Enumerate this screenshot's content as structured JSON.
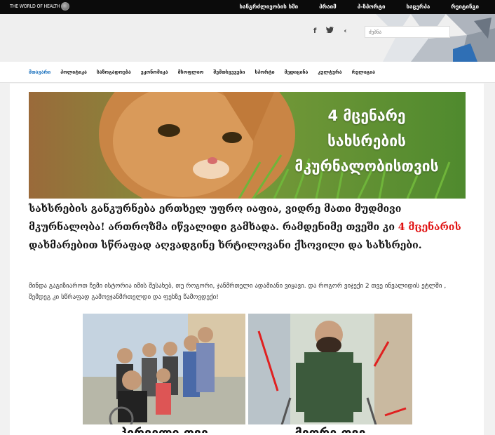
{
  "logo": {
    "text": "THE WORLD OF HEALTH"
  },
  "top_nav": [
    "ხანგრძლივობის ხმი",
    "პრაიმ",
    "პ-ზპორტი",
    "ხაცერპა",
    "რეიტინგი"
  ],
  "header": {
    "social_icons": [
      "facebook-icon",
      "twitter-icon",
      "share-icon"
    ],
    "search_placeholder": "ძებნა"
  },
  "categories": [
    {
      "label": "მთავარი",
      "active": true
    },
    {
      "label": "პოლიტიკა",
      "active": false
    },
    {
      "label": "საზოგადოება",
      "active": false
    },
    {
      "label": "ეკონომიკა",
      "active": false
    },
    {
      "label": "მსოფლიო",
      "active": false
    },
    {
      "label": "შემთხვევები",
      "active": false
    },
    {
      "label": "სპორტი",
      "active": false
    },
    {
      "label": "მედიცინა",
      "active": false
    },
    {
      "label": "კულტურა",
      "active": false
    },
    {
      "label": "რელიგია",
      "active": false
    }
  ],
  "hero": {
    "caption_line1": "4 მცენარე",
    "caption_line2": "სახსრების",
    "caption_line3": "მკურნალობისთვის"
  },
  "article": {
    "lead_part1": "სახსრების განკურნება ერთხელ უფრო იაფია, ვიდრე მათი მუდმივი მკურნალობა! ართროზმა იწვალიდი გამხადა. რამდენიმე თვეში კი ",
    "lead_highlight": "4 მცენარის",
    "lead_part2": " დახმარებით სწრაფად აღვადგინე ხრტილოვანი ქსოვილი და სახსრები.",
    "intro": "მინდა გაგიზიაროთ ჩემი ისტორია იმის შესახებ, თუ როგორი, ჯანმრთელი ადამიანი ვიყავი. და როგორ ვიჯექი 2 თვე ინვალიდის ეტლში , შემდეგ კი სწრაფად გამოვჯანმრთელდი და ფეხზე წამოვდექი!"
  },
  "photos": [
    {
      "caption": "პირველი თვე"
    },
    {
      "caption": "მეორე თვე"
    }
  ],
  "colors": {
    "accent": "#1e73be",
    "highlight": "#e01010",
    "topbar": "#0b0b0b"
  }
}
